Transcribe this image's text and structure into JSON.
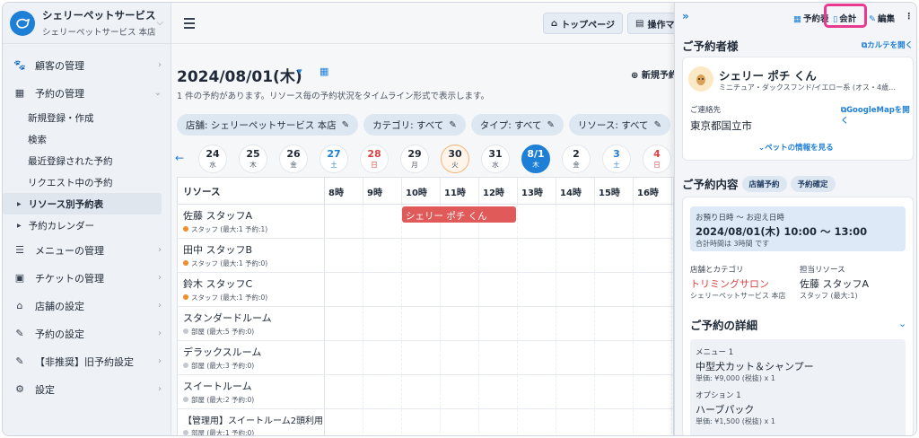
{
  "brand": {
    "name": "シェリーペットサービス",
    "store": "シェリーペットサービス 本店"
  },
  "sidebar": {
    "items": [
      {
        "label": "顧客の管理",
        "icon": "paw-icon"
      },
      {
        "label": "予約の管理",
        "icon": "calendar-icon",
        "expanded": true
      },
      {
        "label": "メニューの管理",
        "icon": "list-icon"
      },
      {
        "label": "チケットの管理",
        "icon": "ticket-icon"
      },
      {
        "label": "店舗の設定",
        "icon": "home-icon"
      },
      {
        "label": "予約の設定",
        "icon": "edit-calendar-icon"
      },
      {
        "label": "【非推奨】旧予約設定",
        "icon": "edit-calendar-icon"
      },
      {
        "label": "設定",
        "icon": "gear-icon"
      }
    ],
    "sub_items": [
      "新規登録・作成",
      "検索",
      "最近登録された予約",
      "リクエスト中の予約",
      "リソース別予約表",
      "予約カレンダー"
    ]
  },
  "topbar": {
    "home_label": "トップページ",
    "manual_label": "操作マニ"
  },
  "main": {
    "date_title": "2024/08/01(木)",
    "new_label": "新規予約",
    "subtitle": "1 件の予約があります。リソース毎の予約状況をタイムライン形式で表示します。",
    "filters": [
      "店舗: シェリーペットサービス 本店",
      "カテゴリ: すべて",
      "タイプ: すべて",
      "リソース: すべて"
    ],
    "days": [
      {
        "n": "24",
        "w": "水",
        "type": ""
      },
      {
        "n": "25",
        "w": "木",
        "type": ""
      },
      {
        "n": "26",
        "w": "金",
        "type": ""
      },
      {
        "n": "27",
        "w": "土",
        "type": "sat"
      },
      {
        "n": "28",
        "w": "日",
        "type": "sun"
      },
      {
        "n": "29",
        "w": "月",
        "type": ""
      },
      {
        "n": "30",
        "w": "火",
        "type": "today"
      },
      {
        "n": "31",
        "w": "水",
        "type": ""
      },
      {
        "n": "8/1",
        "w": "木",
        "type": "sel"
      },
      {
        "n": "2",
        "w": "金",
        "type": ""
      },
      {
        "n": "3",
        "w": "土",
        "type": "sat"
      },
      {
        "n": "4",
        "w": "日",
        "type": "sun"
      }
    ],
    "resource_header": "リソース",
    "hours": [
      "8時",
      "9時",
      "10時",
      "11時",
      "12時",
      "13時",
      "14時",
      "15時",
      "16時"
    ],
    "resources": [
      {
        "name": "佐藤 スタッフA",
        "meta": "スタッフ (最大:1 予約:1)",
        "color": "#f08c2a"
      },
      {
        "name": "田中 スタッフB",
        "meta": "スタッフ (最大:1 予約:0)",
        "color": "#f08c2a"
      },
      {
        "name": "鈴木 スタッフC",
        "meta": "スタッフ (最大:1 予約:0)",
        "color": "#f08c2a"
      },
      {
        "name": "スタンダードルーム",
        "meta": "部屋 (最大:5 予約:0)",
        "color": "#c4c9d0"
      },
      {
        "name": "デラックスルーム",
        "meta": "部屋 (最大:3 予約:0)",
        "color": "#c4c9d0"
      },
      {
        "name": "スイートルーム",
        "meta": "部屋 (最大:2 予約:0)",
        "color": "#c4c9d0"
      },
      {
        "name": "【管理用】スイートルーム2頭利用",
        "meta": "部屋 (最大:1 予約:0)",
        "color": "#c4c9d0"
      }
    ],
    "booking_label": "シェリー ポチ くん"
  },
  "panel": {
    "actions": {
      "reserve": "予約表",
      "checkout": "会計",
      "edit": "編集"
    },
    "customer_title": "ご予約者様",
    "karte_link": "カルテを開く",
    "pet_name": "シェリー ポチ くん",
    "pet_desc": "ミニチュア・ダックスフンド/イエロー系 (オス・4歳…",
    "contact_label": "ご連絡先",
    "map_link": "GoogleMapを開く",
    "address": "東京都国立市",
    "pet_info_link": "ペットの情報を見る",
    "reserve_title": "ご予約内容",
    "tag1": "店舗予約",
    "tag2": "予約確定",
    "datetime_label": "お預り日時 ～ お迎え日時",
    "datetime_value": "2024/08/01(木) 10:00 ～ 13:00",
    "total_time": "合計時間は 3時間 です",
    "store_cat_label": "店舗とカテゴリ",
    "category": "トリミングサロン",
    "store": "シェリーペットサービス 本店",
    "resource_label": "担当リソース",
    "resource_name": "佐藤 スタッフA",
    "resource_meta": "スタッフ (最大:1)",
    "detail_title": "ご予約の詳細",
    "menu_label": "メニュー 1",
    "menu_name": "中型犬カット＆シャンプー",
    "menu_price": "単価: ¥9,000 (税抜) x 1",
    "option_label": "オプション 1",
    "option_name": "ハーブパック",
    "option_price": "単価: ¥1,500 (税抜) x 1"
  }
}
